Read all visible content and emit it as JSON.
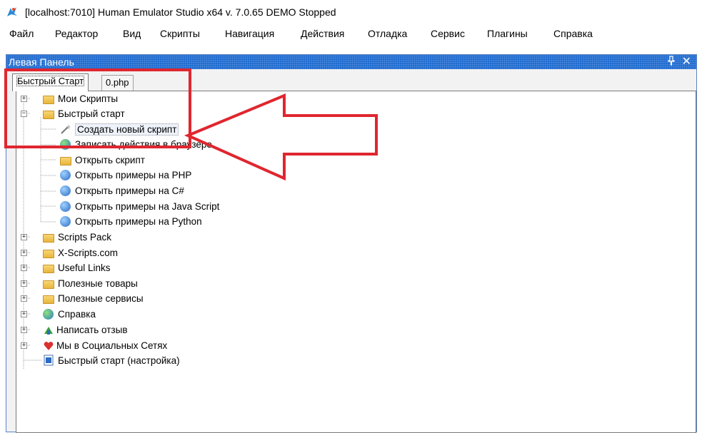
{
  "window": {
    "title": "[localhost:7010] Human Emulator Studio x64 v. 7.0.65 DEMO Stopped"
  },
  "menu": [
    "Файл",
    "Редактор",
    "Вид",
    "Скрипты",
    "Навигация",
    "Действия",
    "Отладка",
    "Сервис",
    "Плагины",
    "Справка"
  ],
  "panel": {
    "title": "Левая Панель",
    "pin": "ᵖ",
    "close": "✕"
  },
  "tabs": [
    "Быстрый Старт",
    "0.php"
  ],
  "tree": {
    "root": [
      {
        "label": "Мои Скрипты",
        "icon": "folder-icon"
      },
      {
        "label": "Быстрый старт",
        "icon": "folder-icon"
      },
      {
        "label": "Scripts Pack",
        "icon": "folder-icon"
      },
      {
        "label": "X-Scripts.com",
        "icon": "folder-icon"
      },
      {
        "label": "Useful Links",
        "icon": "folder-icon"
      },
      {
        "label": "Полезные товары",
        "icon": "folder-icon"
      },
      {
        "label": "Полезные сервисы",
        "icon": "folder-icon"
      },
      {
        "label": "Справка",
        "icon": "globe-icon"
      },
      {
        "label": "Написать отзыв",
        "icon": "feedback-icon"
      },
      {
        "label": "Мы в Социальных Сетях",
        "icon": "heart-icon"
      },
      {
        "label": "Быстрый старт (настройка)",
        "icon": "document-icon"
      }
    ],
    "children": [
      {
        "label": "Создать новый скрипт",
        "icon": "magic-wand-icon"
      },
      {
        "label": "Записать действия в браузере",
        "icon": "globe-icon"
      },
      {
        "label": "Открыть скрипт",
        "icon": "folder-icon"
      },
      {
        "label": "Открыть примеры на PHP",
        "icon": "globe-icon"
      },
      {
        "label": "Открыть примеры на C#",
        "icon": "globe-icon"
      },
      {
        "label": "Открыть примеры на Java Script",
        "icon": "globe-icon"
      },
      {
        "label": "Открыть примеры на Python",
        "icon": "globe-icon"
      }
    ]
  },
  "colors": {
    "accent": "#1f6bd0",
    "highlight": "#e0262f"
  }
}
